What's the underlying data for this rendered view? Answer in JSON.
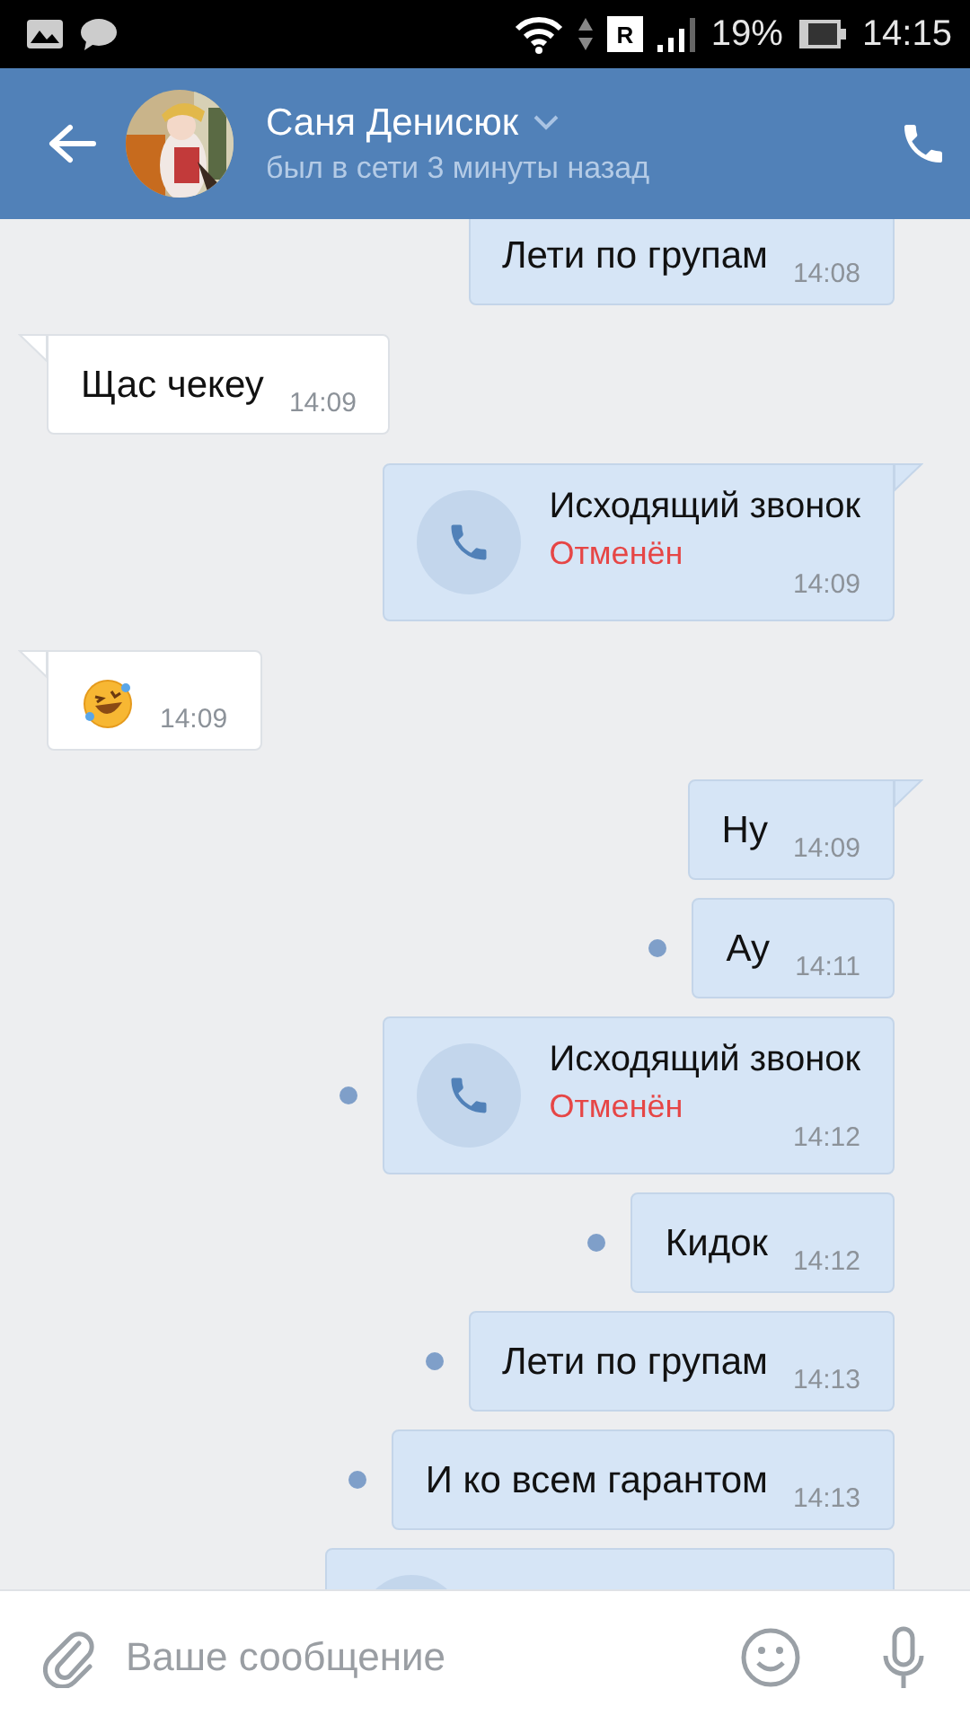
{
  "status_bar": {
    "roaming": "R",
    "battery": "19%",
    "time": "14:15"
  },
  "header": {
    "name": "Саня Денисюк",
    "status": "был в сети 3 минуты назад"
  },
  "messages": [
    {
      "kind": "text",
      "outgoing": true,
      "unread": false,
      "text": "Лети по групам",
      "time": "14:08"
    },
    {
      "kind": "text",
      "outgoing": false,
      "unread": false,
      "text": "Щас чекеу",
      "time": "14:09"
    },
    {
      "kind": "call",
      "outgoing": true,
      "unread": false,
      "title": "Исходящий звонок",
      "status": "Отменён",
      "time": "14:09"
    },
    {
      "kind": "emoji",
      "outgoing": false,
      "unread": false,
      "time": "14:09"
    },
    {
      "kind": "text",
      "outgoing": true,
      "unread": false,
      "text": "Ну",
      "time": "14:09"
    },
    {
      "kind": "text",
      "outgoing": true,
      "unread": true,
      "text": "Ау",
      "time": "14:11"
    },
    {
      "kind": "call",
      "outgoing": true,
      "unread": true,
      "title": "Исходящий звонок",
      "status": "Отменён",
      "time": "14:12"
    },
    {
      "kind": "text",
      "outgoing": true,
      "unread": true,
      "text": "Кидок",
      "time": "14:12"
    },
    {
      "kind": "text",
      "outgoing": true,
      "unread": true,
      "text": "Лети по групам",
      "time": "14:13"
    },
    {
      "kind": "text",
      "outgoing": true,
      "unread": true,
      "text": "И  ко всем гарантом",
      "time": "14:13"
    },
    {
      "kind": "call_cut",
      "outgoing": true
    }
  ],
  "composer": {
    "placeholder": "Ваше сообщение"
  }
}
